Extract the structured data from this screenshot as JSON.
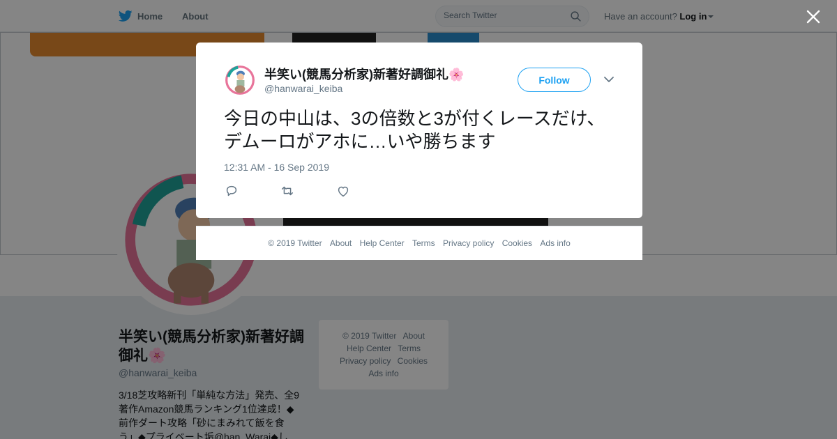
{
  "topbar": {
    "home_label": "Home",
    "about_label": "About",
    "search_placeholder": "Search Twitter",
    "account_prompt": "Have an account?",
    "login_label": "Log in"
  },
  "profile": {
    "name": "半笑い(競馬分析家)新著好調御礼🌸",
    "handle": "@hanwarai_keiba",
    "bio_lines": [
      "3/18芝攻略新刊「単純な方法」発売、全9",
      "著作Amazon競馬ランキング1位達成！◆",
      "前作ダート攻略「砂にまみれて飯を食",
      "う」◆プライベート垢@han_Warai◆し"
    ]
  },
  "sidebar_footer": {
    "copyright": "© 2019 Twitter",
    "about": "About",
    "help": "Help Center",
    "terms": "Terms",
    "privacy": "Privacy policy",
    "cookies": "Cookies",
    "ads": "Ads info"
  },
  "tweet": {
    "author_name": "半笑い(競馬分析家)新著好調御礼🌸",
    "author_handle": "@hanwarai_keiba",
    "follow_label": "Follow",
    "text": "今日の中山は、3の倍数と3が付くレースだけ、デムーロがアホに…いや勝ちます",
    "timestamp": "12:31 AM - 16 Sep 2019"
  },
  "modal_footer": {
    "copyright": "© 2019 Twitter",
    "about": "About",
    "help": "Help Center",
    "terms": "Terms",
    "privacy": "Privacy policy",
    "cookies": "Cookies",
    "ads": "Ads info"
  },
  "colors": {
    "twitter_blue": "#1da1f2",
    "text_primary": "#14171a",
    "text_secondary": "#657786",
    "overlay": "rgba(0,0,0,0.48)"
  },
  "icons": [
    "twitter-bird-icon",
    "search-icon",
    "close-icon",
    "chevron-down-icon",
    "reply-icon",
    "retweet-icon",
    "like-icon"
  ]
}
